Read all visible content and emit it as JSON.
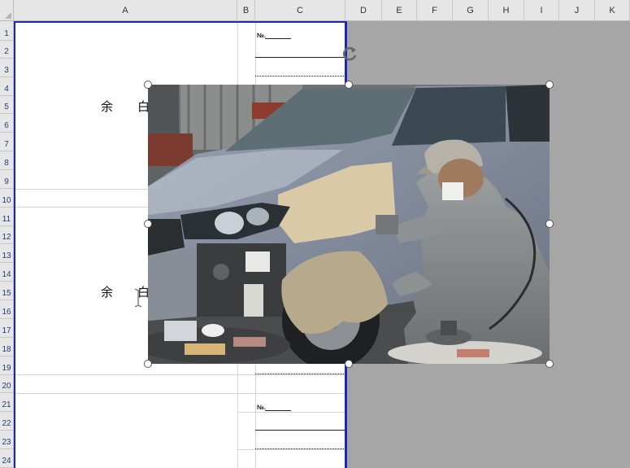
{
  "columns": [
    "A",
    "B",
    "C",
    "D",
    "E",
    "F",
    "G",
    "H",
    "I",
    "J",
    "K"
  ],
  "rows": [
    "1",
    "2",
    "3",
    "4",
    "5",
    "6",
    "7",
    "8",
    "9",
    "10",
    "11",
    "12",
    "13",
    "14",
    "15",
    "16",
    "17",
    "18",
    "19",
    "20",
    "21",
    "22",
    "23",
    "24"
  ],
  "cells": {
    "yohaku_top": "余　　白",
    "yohaku_bottom": "余　　白",
    "no_label_1": "№.",
    "no_label_2": "№."
  },
  "picture": {
    "description_icon": "car-bodywork-photo",
    "selected": true
  },
  "colors": {
    "page_break": "#1c27b5",
    "background": "#a6a6a6",
    "header_bg": "#e6e6e6"
  }
}
